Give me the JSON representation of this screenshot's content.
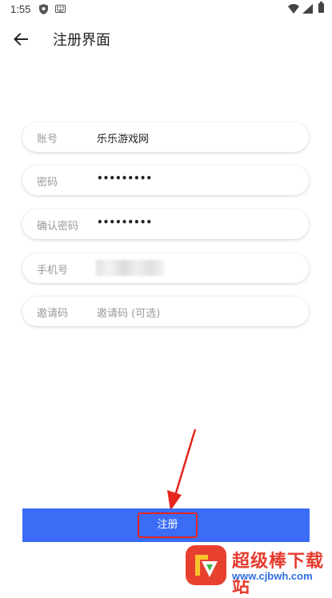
{
  "status_bar": {
    "time": "1:55"
  },
  "app_bar": {
    "title": "注册界面"
  },
  "form": {
    "account": {
      "label": "账号",
      "value": "乐乐游戏网"
    },
    "password": {
      "label": "密码",
      "value": "•••••••••"
    },
    "confirm_password": {
      "label": "确认密码",
      "value": "•••••••••"
    },
    "phone": {
      "label": "手机号"
    },
    "invite_code": {
      "label": "邀请码",
      "placeholder": "邀请码 (可选)"
    }
  },
  "register_button": {
    "label": "注册"
  },
  "watermark": {
    "title": "超级棒下载站",
    "url": "www.cjbwh.com"
  },
  "colors": {
    "accent": "#3b6cf6",
    "highlight": "#e5261f"
  }
}
